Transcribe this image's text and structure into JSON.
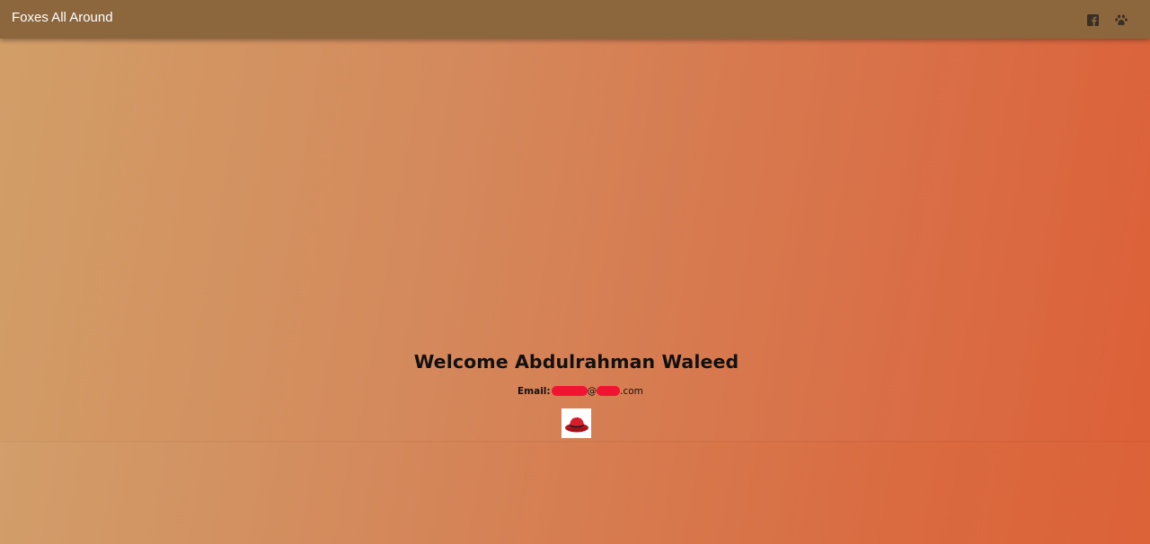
{
  "appbar": {
    "title": "Foxes All Around",
    "icons": [
      "facebook-icon",
      "paw-icon"
    ]
  },
  "profile": {
    "welcome": "Welcome Abdulrahman Waleed",
    "email_label": "Email:",
    "email_at": "@",
    "email_suffix": ".com",
    "avatar_icon": "red-hat-icon"
  },
  "colors": {
    "appbar": "#8c673e",
    "gradient_start": "#d29e68",
    "gradient_end": "#dc6038",
    "redaction": "#f01432",
    "hat_red": "#d71f2c"
  }
}
